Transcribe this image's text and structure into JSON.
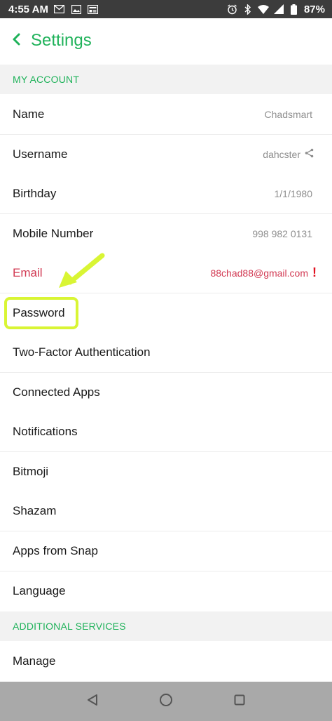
{
  "status_bar": {
    "time": "4:55 AM",
    "battery": "87%"
  },
  "header": {
    "title": "Settings"
  },
  "sections": {
    "my_account": "MY ACCOUNT",
    "additional_services": "ADDITIONAL SERVICES"
  },
  "rows": {
    "name": {
      "label": "Name",
      "value": "Chadsmart"
    },
    "username": {
      "label": "Username",
      "value": "dahcster"
    },
    "birthday": {
      "label": "Birthday",
      "value": "1/1/1980"
    },
    "mobile": {
      "label": "Mobile Number",
      "value": "998 982 0131"
    },
    "email": {
      "label": "Email",
      "value": "88chad88@gmail.com",
      "alert": "!"
    },
    "password": {
      "label": "Password"
    },
    "two_factor": {
      "label": "Two-Factor Authentication"
    },
    "connected_apps": {
      "label": "Connected Apps"
    },
    "notifications": {
      "label": "Notifications"
    },
    "bitmoji": {
      "label": "Bitmoji"
    },
    "shazam": {
      "label": "Shazam"
    },
    "apps_from_snap": {
      "label": "Apps from Snap"
    },
    "language": {
      "label": "Language"
    },
    "manage": {
      "label": "Manage"
    }
  },
  "icons": {
    "back": "chevron-left-icon",
    "share": "share-icon",
    "nav_back": "triangle-back-icon",
    "nav_home": "circle-home-icon",
    "nav_recents": "square-recents-icon"
  },
  "colors": {
    "accent": "#1fb25a",
    "email_red": "#d23a53",
    "highlight": "#d9f534",
    "status_bar": "#3c3c3c",
    "nav_bar": "#a9a9a9"
  }
}
